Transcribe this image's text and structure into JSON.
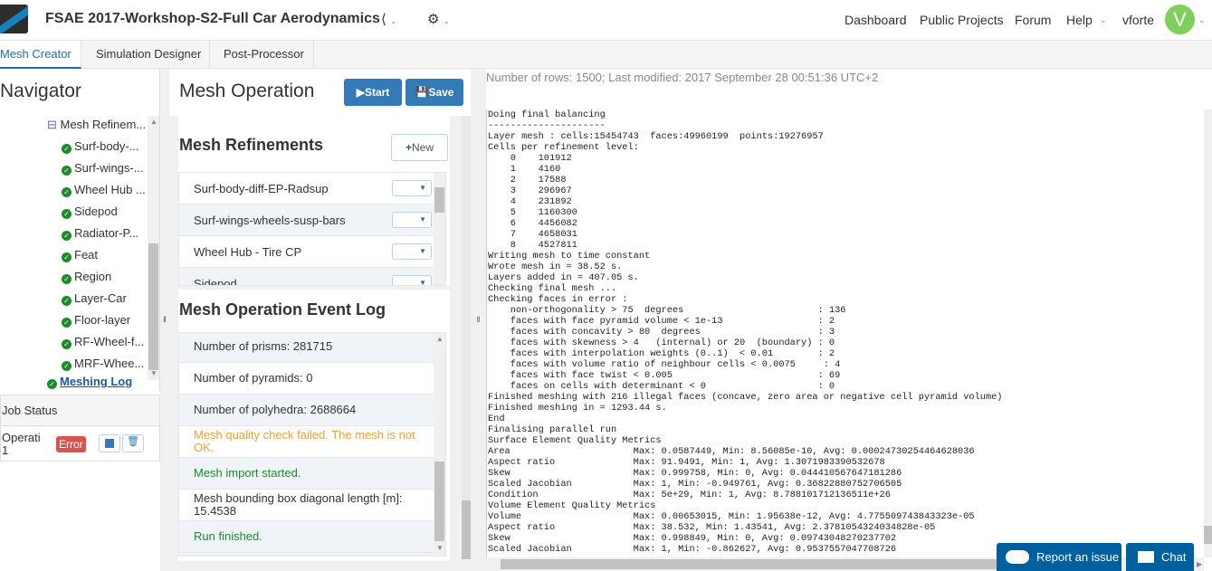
{
  "header": {
    "title": "FSAE 2017-Workshop-S2-Full Car Aerodynamics",
    "nav": [
      "Dashboard",
      "Public Projects",
      "Forum",
      "Help"
    ],
    "user": "vforte",
    "avatar_letter": "V"
  },
  "tabs": [
    "Mesh Creator",
    "Simulation Designer",
    "Post-Processor"
  ],
  "navigator": {
    "title": "Navigator",
    "parent": "Mesh Refinem...",
    "items": [
      "Surf-body-...",
      "Surf-wings-...",
      "Wheel Hub ...",
      "Sidepod",
      "Radiator-P...",
      "Feat",
      "Region",
      "Layer-Car",
      "Floor-layer",
      "RF-Wheel-f...",
      "MRF-Whee..."
    ],
    "meshing_log": "Meshing Log"
  },
  "job_status": {
    "title": "Job Status",
    "name": "Operati\n1",
    "status": "Error",
    "status_color": "#d9534f"
  },
  "mesh_operation": {
    "title": "Mesh Operation",
    "start": "Start",
    "save": "Save",
    "refinements_title": "Mesh Refinements",
    "new_label": "New",
    "refinements": [
      "Surf-body-diff-EP-Radsup",
      "Surf-wings-wheels-susp-bars",
      "Wheel Hub - Tire CP",
      "Sidepod"
    ],
    "event_log_title": "Mesh Operation Event Log",
    "events": [
      {
        "text": "Number of prisms: 281715",
        "color": "#333"
      },
      {
        "text": "Number of pyramids: 0",
        "color": "#333"
      },
      {
        "text": "Number of polyhedra: 2688664",
        "color": "#333"
      },
      {
        "text": "Mesh quality check failed. The mesh is not OK.",
        "color": "#f0a030"
      },
      {
        "text": "Mesh import started.",
        "color": "#1e8a2e"
      },
      {
        "text": "Mesh bounding box diagonal length [m]: 15.4538",
        "color": "#333"
      },
      {
        "text": "Run finished.",
        "color": "#1e8a2e"
      }
    ]
  },
  "log": {
    "meta": "Number of rows: 1500; Last modified: 2017 September 28 00:51:36 UTC+2",
    "lines": [
      "Doing final balancing",
      "---------------------",
      "Layer mesh : cells:15454743  faces:49960199  points:19276957",
      "Cells per refinement level:",
      "    0    101912",
      "    1    4160",
      "    2    17588",
      "    3    296967",
      "    4    231892",
      "    5    1160300",
      "    6    4456082",
      "    7    4658031",
      "    8    4527811",
      "Writing mesh to time constant",
      "Wrote mesh in = 38.52 s.",
      "Layers added in = 407.05 s.",
      "Checking final mesh ...",
      "Checking faces in error :",
      "    non-orthogonality > 75  degrees                        : 136",
      "    faces with face pyramid volume < 1e-13                 : 2",
      "    faces with concavity > 80  degrees                     : 3",
      "    faces with skewness > 4   (internal) or 20  (boundary) : 0",
      "    faces with interpolation weights (0..1)  < 0.01        : 2",
      "    faces with volume ratio of neighbour cells < 0.0075     : 4",
      "    faces with face twist < 0.005                          : 69",
      "    faces on cells with determinant < 0                    : 0",
      "Finished meshing with 216 illegal faces (concave, zero area or negative cell pyramid volume)",
      "Finished meshing in = 1293.44 s.",
      "End",
      "Finalising parallel run",
      "Surface Element Quality Metrics",
      "Area                      Max: 0.0587449, Min: 8.56085e-10, Avg: 0.00024730254464628036",
      "Aspect ratio              Max: 91.9491, Min: 1, Avg: 1.3071983390532678",
      "Skew                      Max: 0.999758, Min: 0, Avg: 0.044410567647181286",
      "Scaled Jacobian           Max: 1, Min: -0.949761, Avg: 0.36822880752706505",
      "Condition                 Max: 5e+29, Min: 1, Avg: 8.788101712136511e+26",
      "Volume Element Quality Metrics",
      "Volume                    Max: 0.00653015, Min: 1.95638e-12, Avg: 4.775509743843323e-05",
      "Aspect ratio              Max: 38.532, Min: 1.43541, Avg: 2.3781054324034828e-05",
      "Skew                      Max: 0.998849, Min: 0, Avg: 0.09743048270237702",
      "Scaled Jacobian           Max: 1, Min: -0.862627, Avg: 0.9537557047708726"
    ]
  },
  "footer": {
    "report": "Report an issue",
    "chat": "Chat"
  }
}
